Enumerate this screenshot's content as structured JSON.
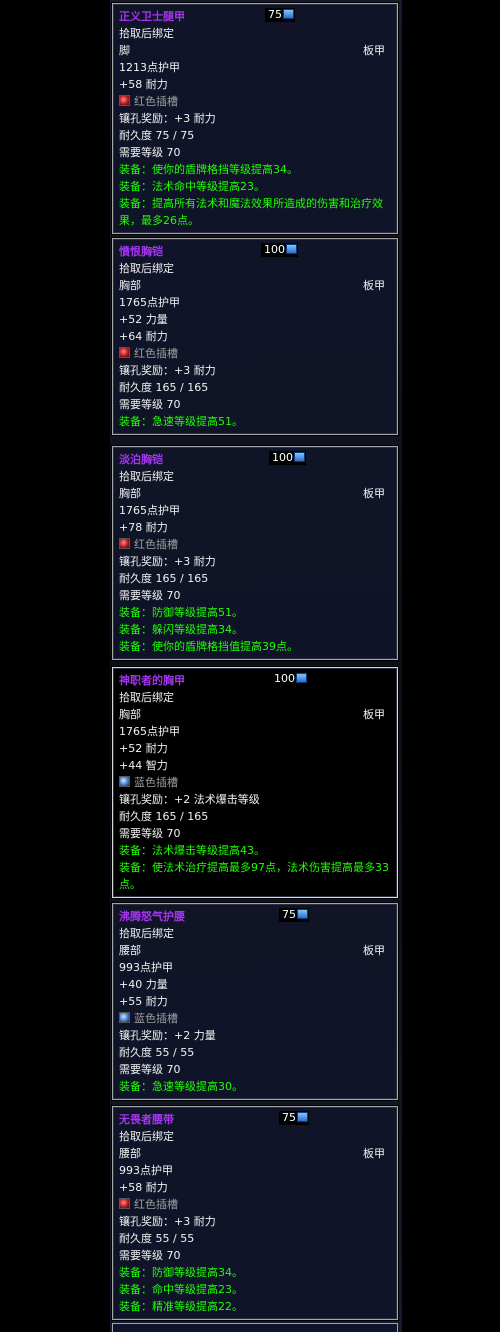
{
  "tooltips": [
    {
      "name": "正义卫士腿甲",
      "ilvl": "75",
      "bind": "拾取后绑定",
      "slot": "脚",
      "armor_type": "板甲",
      "stats": [
        "1213点护甲",
        "+58 耐力"
      ],
      "socket": {
        "color": "red",
        "label": "红色插槽"
      },
      "socket_bonus": "镶孔奖励：+3 耐力",
      "durability": "耐久度 75 / 75",
      "req_level": "需要等级 70",
      "effects": [
        "装备：使你的盾牌格挡等级提高34。",
        "装备：法术命中等级提高23。",
        "装备：提高所有法术和魔法效果所造成的伤害和治疗效果，最多26点。"
      ]
    },
    {
      "name": "憤恨胸铠",
      "ilvl": "100",
      "bind": "拾取后绑定",
      "slot": "胸部",
      "armor_type": "板甲",
      "stats": [
        "1765点护甲",
        "+52 力量",
        "+64 耐力"
      ],
      "socket": {
        "color": "red",
        "label": "红色插槽"
      },
      "socket_bonus": "镶孔奖励：+3 耐力",
      "durability": "耐久度 165 / 165",
      "req_level": "需要等级 70",
      "effects": [
        "装备：急速等级提高51。"
      ]
    },
    {
      "name": "淡泊胸铠",
      "ilvl": "100",
      "bind": "拾取后绑定",
      "slot": "胸部",
      "armor_type": "板甲",
      "stats": [
        "1765点护甲",
        "+78 耐力"
      ],
      "socket": {
        "color": "red",
        "label": "红色插槽"
      },
      "socket_bonus": "镶孔奖励：+3 耐力",
      "durability": "耐久度 165 / 165",
      "req_level": "需要等级 70",
      "effects": [
        "装备：防御等级提高51。",
        "装备：躲闪等级提高34。",
        "装备：使你的盾牌格挡值提高39点。"
      ]
    },
    {
      "name": "神职者的胸甲",
      "ilvl": "100",
      "bind": "拾取后绑定",
      "slot": "胸部",
      "armor_type": "板甲",
      "stats": [
        "1765点护甲",
        "+52 耐力",
        "+44 智力"
      ],
      "socket": {
        "color": "blue",
        "label": "蓝色插槽"
      },
      "socket_bonus": "镶孔奖励：+2 法术爆击等级",
      "durability": "耐久度 165 / 165",
      "req_level": "需要等级 70",
      "effects": [
        "装备：法术爆击等级提高43。",
        "装备：使法术治疗提高最多97点，法术伤害提高最多33点。"
      ]
    },
    {
      "name": "沸腾怒气护腰",
      "ilvl": "75",
      "bind": "拾取后绑定",
      "slot": "腰部",
      "armor_type": "板甲",
      "stats": [
        "993点护甲",
        "+40 力量",
        "+55 耐力"
      ],
      "socket": {
        "color": "blue",
        "label": "蓝色插槽"
      },
      "socket_bonus": "镶孔奖励：+2 力量",
      "durability": "耐久度 55 / 55",
      "req_level": "需要等级 70",
      "effects": [
        "装备：急速等级提高30。"
      ]
    },
    {
      "name": "无畏者腰带",
      "ilvl": "75",
      "bind": "拾取后绑定",
      "slot": "腰部",
      "armor_type": "板甲",
      "stats": [
        "993点护甲",
        "+58 耐力"
      ],
      "socket": {
        "color": "red",
        "label": "红色插槽"
      },
      "socket_bonus": "镶孔奖励：+3 耐力",
      "durability": "耐久度 55 / 55",
      "req_level": "需要等级 70",
      "effects": [
        "装备：防御等级提高34。",
        "装备：命中等级提高23。",
        "装备：精准等级提高22。"
      ]
    }
  ]
}
